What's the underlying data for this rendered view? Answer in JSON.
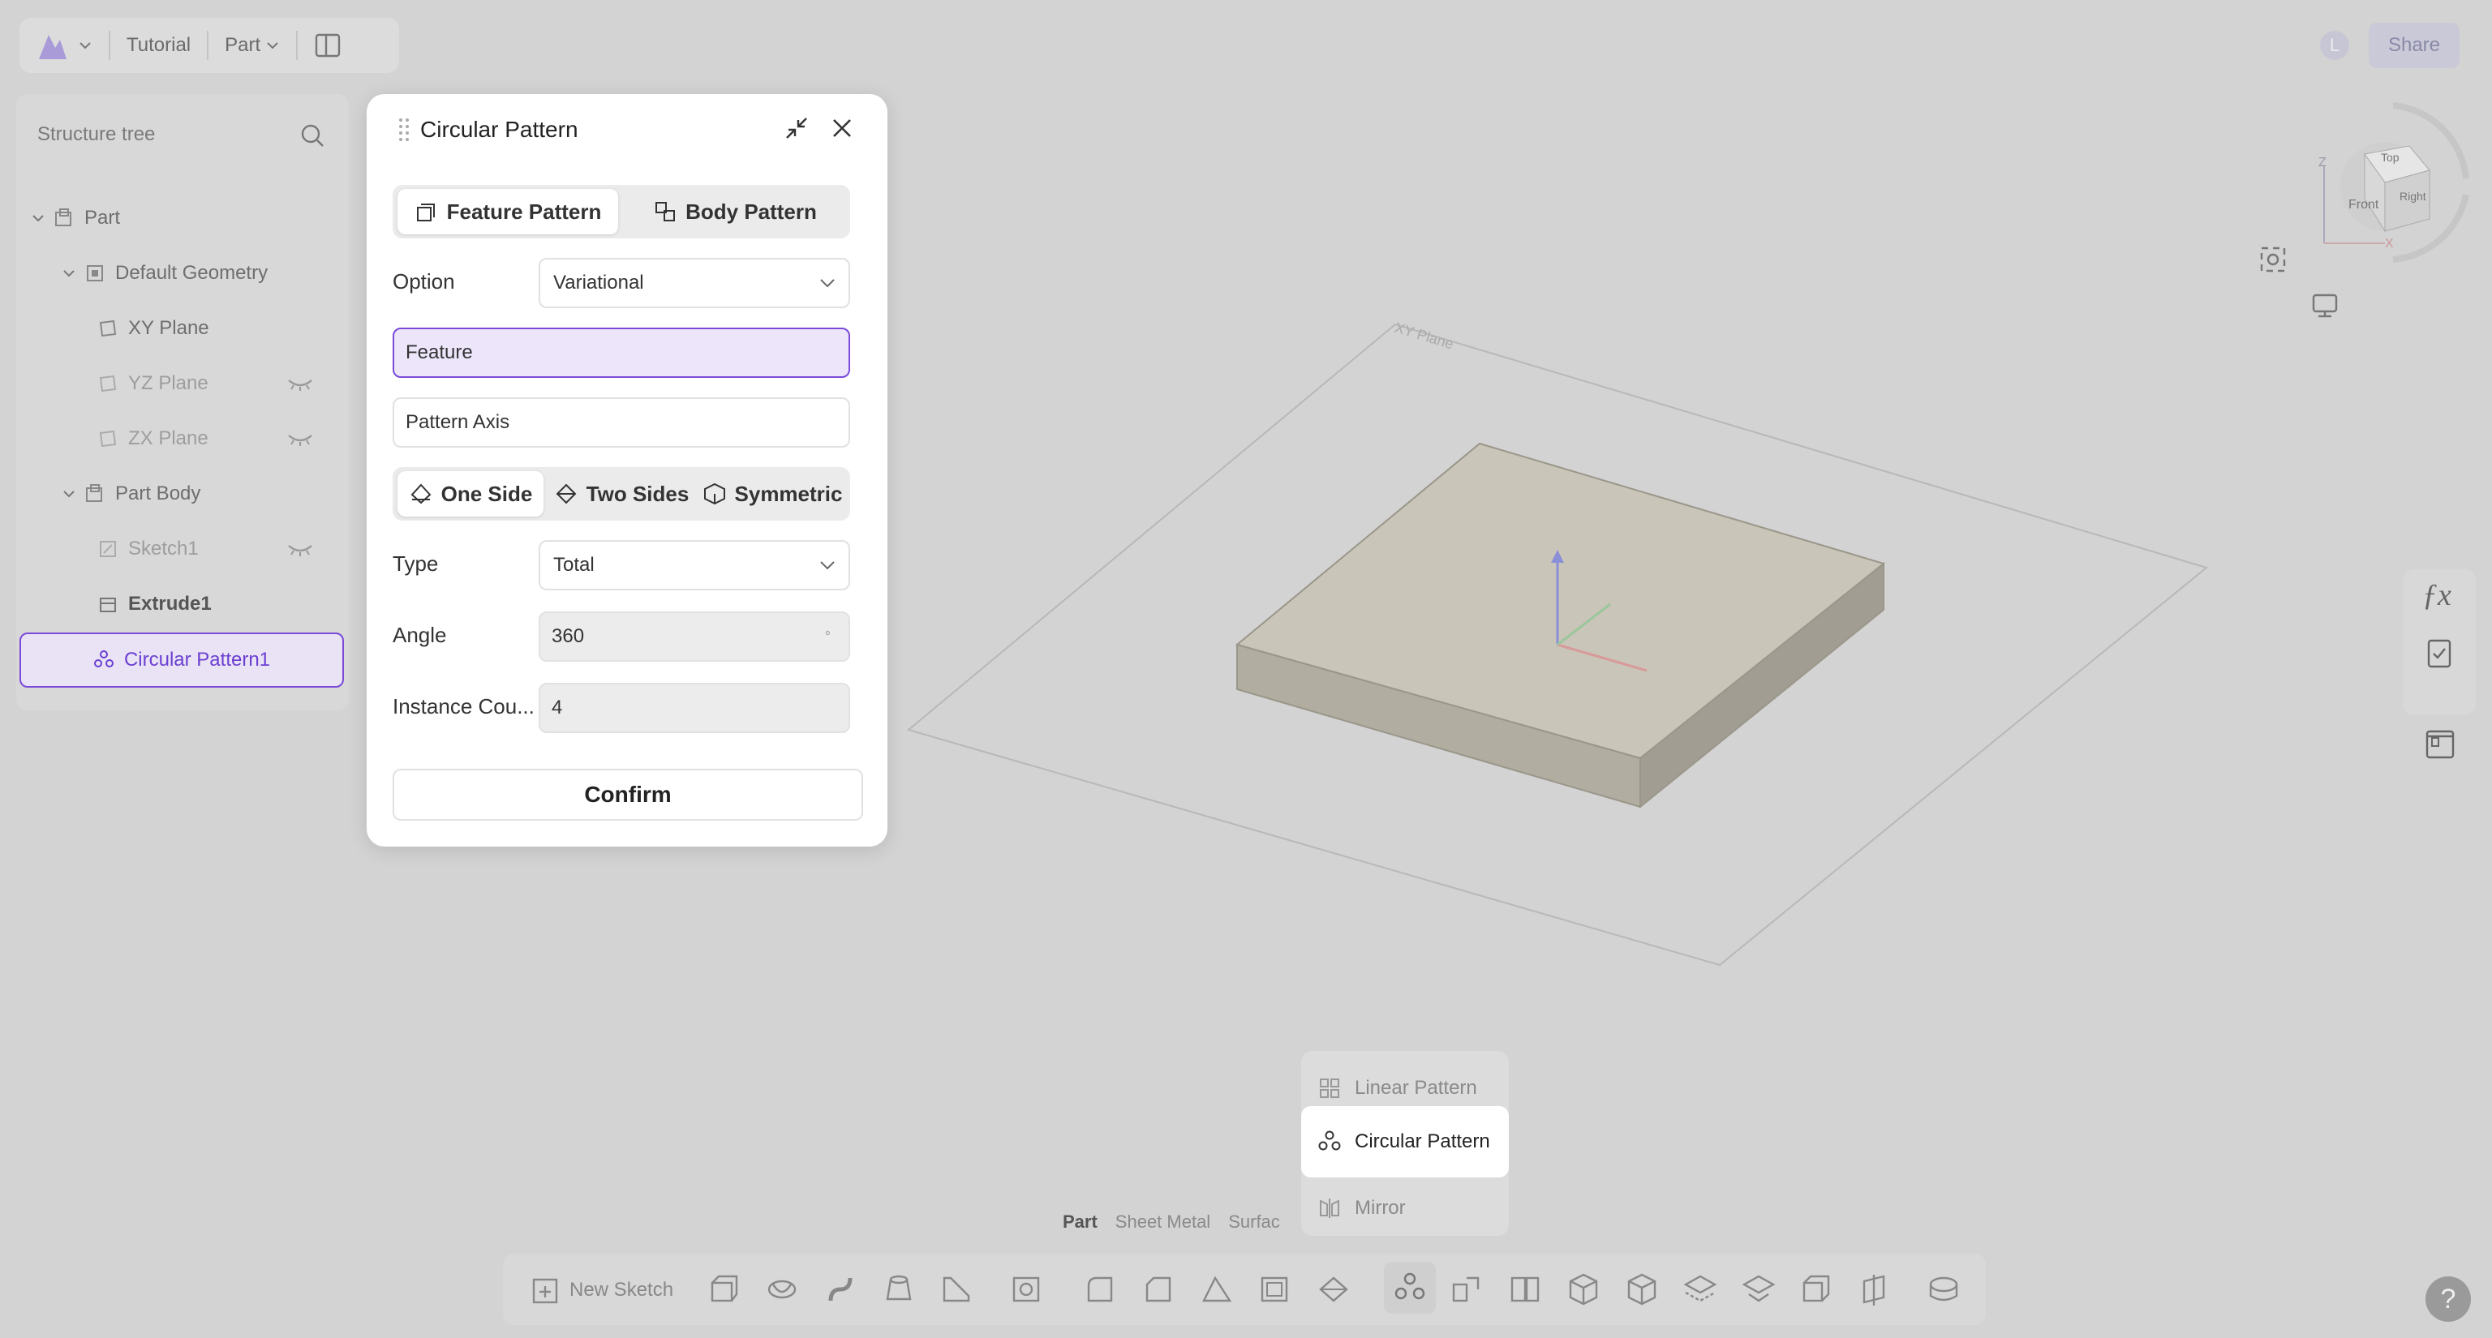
{
  "topbar": {
    "logo_icon": "app-logo-icon",
    "tutorial": "Tutorial",
    "part_menu": "Part"
  },
  "header_right": {
    "avatar": "L",
    "share": "Share"
  },
  "tree": {
    "search_placeholder": "Structure tree",
    "nodes": [
      {
        "label": "Part"
      },
      {
        "label": "Default Geometry"
      },
      {
        "label": "XY Plane"
      },
      {
        "label": "YZ Plane"
      },
      {
        "label": "ZX Plane"
      },
      {
        "label": "Part Body"
      },
      {
        "label": "Sketch1"
      },
      {
        "label": "Extrude1"
      },
      {
        "label": "Circular Pattern1"
      }
    ]
  },
  "dialog": {
    "title": "Circular Pattern",
    "mode_tabs": [
      "Feature Pattern",
      "Body Pattern"
    ],
    "option_label": "Option",
    "option_value": "Variational",
    "feature_field": "Feature",
    "axis_field": "Pattern Axis",
    "direction_tabs": [
      "One Side",
      "Two Sides",
      "Symmetric"
    ],
    "type_label": "Type",
    "type_value": "Total",
    "angle_label": "Angle",
    "angle_value": "360",
    "angle_unit": "°",
    "count_label": "Instance Cou...",
    "count_value": "4",
    "confirm": "Confirm"
  },
  "viewport": {
    "plane_label": "XY Plane",
    "cube_faces": [
      "Top",
      "Front",
      "Right"
    ],
    "axes": [
      "Z",
      "X"
    ]
  },
  "pattern_menu": [
    "Linear Pattern",
    "Circular Pattern",
    "Mirror"
  ],
  "bottom_tabs": [
    "Part",
    "Sheet Metal",
    "Surfac"
  ],
  "toolbar": {
    "new_sketch": "New Sketch"
  },
  "help": "?",
  "colors": {
    "accent": "#7b4ad8",
    "accent_bg": "#ede6fb",
    "overlay": "#d3d3d3",
    "box_top": "#c9c5b8"
  }
}
